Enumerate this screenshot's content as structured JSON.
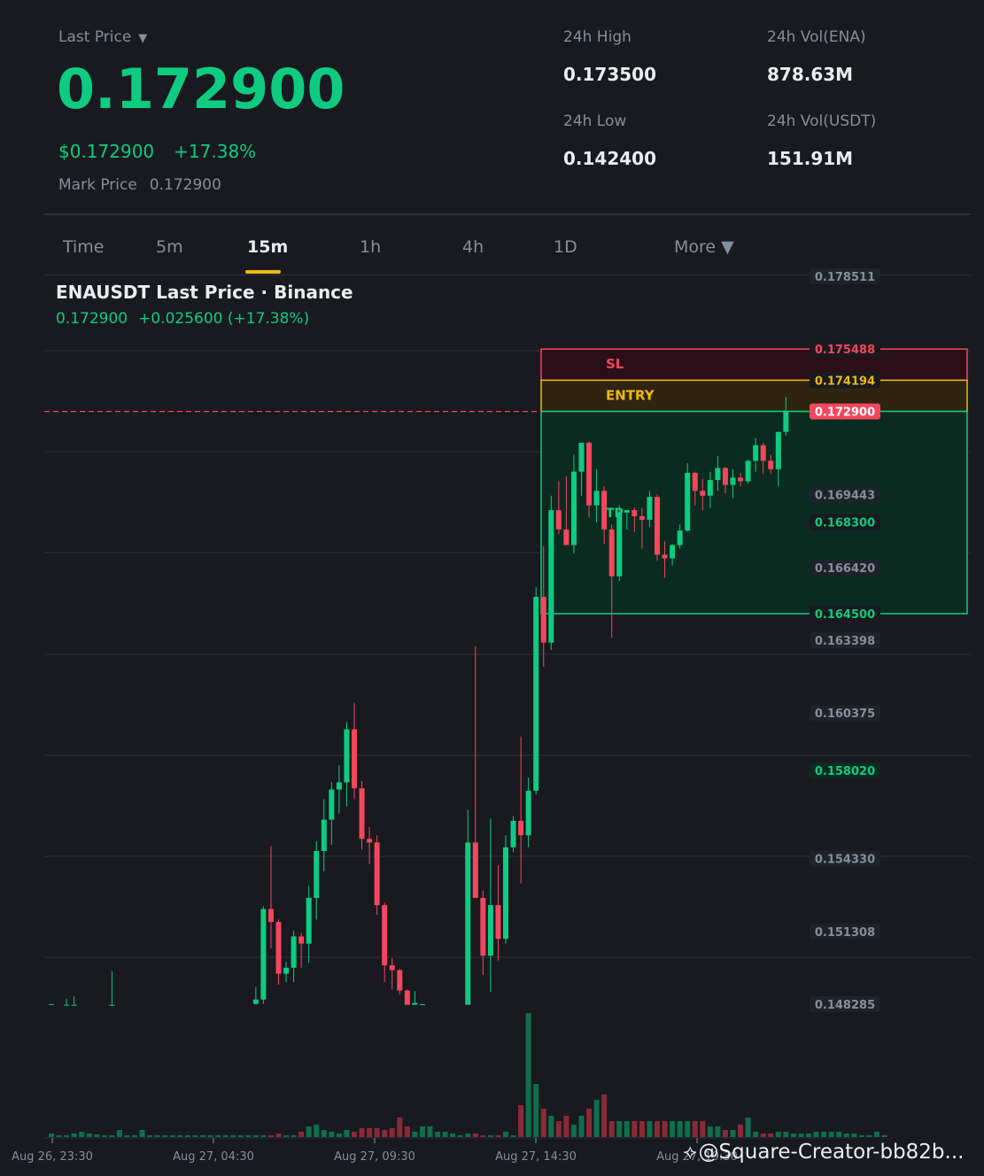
{
  "header": {
    "last_price_label": "Last Price",
    "last_price": "0.172900",
    "usd_price": "$0.172900",
    "change_pct": "+17.38%",
    "mark_price_label": "Mark Price",
    "mark_price": "0.172900",
    "stats": {
      "high_label": "24h High",
      "high": "0.173500",
      "low_label": "24h Low",
      "low": "0.142400",
      "vol_base_label": "24h Vol(ENA)",
      "vol_base": "878.63M",
      "vol_quote_label": "24h Vol(USDT)",
      "vol_quote": "151.91M"
    }
  },
  "tabs": [
    "Time",
    "5m",
    "15m",
    "1h",
    "4h",
    "1D",
    "More ▼"
  ],
  "active_tab": "15m",
  "chart": {
    "title": "ENAUSDT Last Price · Binance",
    "sub_price": "0.172900",
    "sub_change": "+0.025600 (+17.38%)"
  },
  "watermark": "@Square-Creator-bb82b...",
  "colors": {
    "up": "#0ecb81",
    "down": "#f6465d",
    "accent": "#f0b90b",
    "bg": "#181a20"
  },
  "chart_data": {
    "type": "candlestick",
    "symbol": "ENAUSDT",
    "interval": "15m",
    "price_range": [
      0.148285,
      0.178511
    ],
    "y_tick_labels": [
      "0.178511",
      "0.175488",
      "0.174194",
      "0.172900",
      "0.169443",
      "0.168300",
      "0.166420",
      "0.164500",
      "0.163398",
      "0.160375",
      "0.158020",
      "0.154330",
      "0.151308",
      "0.148285"
    ],
    "x_tick_labels": [
      "Aug 26, 23:30",
      "Aug 27, 04:30",
      "Aug 27, 09:30",
      "Aug 27, 14:30",
      "Aug 27, 19:30"
    ],
    "levels": {
      "stop_loss": {
        "label": "SL",
        "price": 0.175488
      },
      "entry": {
        "label": "ENTRY",
        "price": 0.174194
      },
      "last_price": {
        "price": 0.1729
      },
      "take_profit": {
        "label": "TP",
        "price": 0.1645
      }
    },
    "candles": [
      [
        0.14829,
        0.14829,
        0.14826,
        0.14829
      ],
      [
        0.14826,
        0.14826,
        0.14826,
        0.14829
      ],
      [
        0.14826,
        0.14851,
        0.14826,
        0.14826
      ],
      [
        0.14826,
        0.14861,
        0.14826,
        0.14826
      ],
      [
        0.14826,
        0.14826,
        0.14826,
        0.14829
      ],
      [
        0.14826,
        0.14826,
        0.14826,
        0.14826
      ],
      [
        0.14826,
        0.14826,
        0.14826,
        0.14826
      ],
      [
        0.14826,
        0.14826,
        0.14826,
        0.14826
      ],
      [
        0.14826,
        0.14965,
        0.14826,
        0.14826
      ],
      [
        0.14826,
        0.14826,
        0.14826,
        0.14826
      ],
      [
        0.14826,
        0.14826,
        0.14826,
        0.14826
      ],
      [
        0.14826,
        0.14826,
        0.14826,
        0.14826
      ],
      [
        0.14826,
        0.14826,
        0.14826,
        0.14826
      ],
      [
        0.14826,
        0.14826,
        0.14826,
        0.14826
      ],
      [
        0.14826,
        0.14826,
        0.14826,
        0.14826
      ],
      [
        0.14826,
        0.14826,
        0.14826,
        0.14826
      ],
      [
        0.14826,
        0.14826,
        0.14826,
        0.14826
      ],
      [
        0.14826,
        0.14826,
        0.14826,
        0.14826
      ],
      [
        0.14826,
        0.14826,
        0.14826,
        0.14826
      ],
      [
        0.14826,
        0.14826,
        0.14826,
        0.14826
      ],
      [
        0.14826,
        0.14826,
        0.14826,
        0.14826
      ],
      [
        0.14826,
        0.14826,
        0.14826,
        0.14826
      ],
      [
        0.14826,
        0.14826,
        0.14826,
        0.14826
      ],
      [
        0.14826,
        0.14826,
        0.14826,
        0.14826
      ],
      [
        0.14826,
        0.14826,
        0.14826,
        0.14826
      ],
      [
        0.14826,
        0.14826,
        0.14826,
        0.14826
      ],
      [
        0.14826,
        0.14826,
        0.14826,
        0.14826
      ],
      [
        0.1483,
        0.149,
        0.14826,
        0.14848
      ],
      [
        0.14848,
        0.15235,
        0.1483,
        0.15224
      ],
      [
        0.15224,
        0.15485,
        0.1506,
        0.1517
      ],
      [
        0.1517,
        0.1518,
        0.1491,
        0.14955
      ],
      [
        0.14955,
        0.15005,
        0.1492,
        0.1498
      ],
      [
        0.1498,
        0.15135,
        0.1492,
        0.1511
      ],
      [
        0.1511,
        0.15125,
        0.1498,
        0.1508
      ],
      [
        0.1508,
        0.1532,
        0.15,
        0.1527
      ],
      [
        0.1527,
        0.15505,
        0.1518,
        0.15465
      ],
      [
        0.15465,
        0.1568,
        0.1538,
        0.15595
      ],
      [
        0.15595,
        0.1575,
        0.1549,
        0.1572
      ],
      [
        0.1572,
        0.1582,
        0.1562,
        0.1575
      ],
      [
        0.1575,
        0.16,
        0.1565,
        0.1597
      ],
      [
        0.1597,
        0.1608,
        0.1568,
        0.15725
      ],
      [
        0.15725,
        0.15755,
        0.1547,
        0.15515
      ],
      [
        0.15515,
        0.15565,
        0.1541,
        0.155
      ],
      [
        0.155,
        0.1553,
        0.152,
        0.1524
      ],
      [
        0.1524,
        0.1525,
        0.1492,
        0.1499
      ],
      [
        0.1499,
        0.1502,
        0.1489,
        0.1497
      ],
      [
        0.1497,
        0.14975,
        0.1487,
        0.14885
      ],
      [
        0.14885,
        0.1489,
        0.14826,
        0.14826
      ],
      [
        0.14826,
        0.14883,
        0.14826,
        0.14834
      ],
      [
        0.14826,
        0.1483,
        0.14826,
        0.14828
      ],
      [
        0.14826,
        0.14826,
        0.14826,
        0.14826
      ],
      [
        0.14826,
        0.14826,
        0.14826,
        0.14826
      ],
      [
        0.14826,
        0.14826,
        0.14826,
        0.14826
      ],
      [
        0.14826,
        0.14826,
        0.14826,
        0.14826
      ],
      [
        0.14826,
        0.14826,
        0.14826,
        0.14826
      ],
      [
        0.14826,
        0.15635,
        0.14826,
        0.155
      ],
      [
        0.155,
        0.16315,
        0.1533,
        0.1527
      ],
      [
        0.1527,
        0.153,
        0.1495,
        0.1503
      ],
      [
        0.1503,
        0.156,
        0.1488,
        0.1524
      ],
      [
        0.1524,
        0.15405,
        0.1501,
        0.151
      ],
      [
        0.151,
        0.1553,
        0.1508,
        0.1548
      ],
      [
        0.1548,
        0.1561,
        0.1546,
        0.1559
      ],
      [
        0.1559,
        0.1594,
        0.1533,
        0.1553
      ],
      [
        0.1553,
        0.1577,
        0.1548,
        0.15715
      ],
      [
        0.15715,
        0.1656,
        0.157,
        0.1652
      ],
      [
        0.1652,
        0.1673,
        0.1623,
        0.1633
      ],
      [
        0.1633,
        0.1694,
        0.163,
        0.1688
      ],
      [
        0.1688,
        0.17,
        0.1678,
        0.168
      ],
      [
        0.168,
        0.1702,
        0.1676,
        0.16735
      ],
      [
        0.16735,
        0.1711,
        0.167,
        0.1704
      ],
      [
        0.1704,
        0.1712,
        0.1694,
        0.1716
      ],
      [
        0.1716,
        0.17165,
        0.1685,
        0.169
      ],
      [
        0.169,
        0.1705,
        0.1683,
        0.1696
      ],
      [
        0.1696,
        0.1698,
        0.1674,
        0.168
      ],
      [
        0.168,
        0.1682,
        0.1635,
        0.16605
      ],
      [
        0.16605,
        0.169,
        0.16585,
        0.1687
      ],
      [
        0.1687,
        0.1688,
        0.168,
        0.1688
      ],
      [
        0.1688,
        0.1689,
        0.1679,
        0.16855
      ],
      [
        0.16855,
        0.1689,
        0.1672,
        0.1684
      ],
      [
        0.1684,
        0.1696,
        0.1681,
        0.16935
      ],
      [
        0.16935,
        0.16945,
        0.1667,
        0.16695
      ],
      [
        0.16695,
        0.1675,
        0.166,
        0.1668
      ],
      [
        0.1668,
        0.1674,
        0.1665,
        0.16735
      ],
      [
        0.16735,
        0.1682,
        0.1672,
        0.16795
      ],
      [
        0.16795,
        0.17075,
        0.1679,
        0.17035
      ],
      [
        0.17035,
        0.1704,
        0.169,
        0.1696
      ],
      [
        0.1696,
        0.1701,
        0.1688,
        0.1694
      ],
      [
        0.1694,
        0.1704,
        0.1689,
        0.17005
      ],
      [
        0.17005,
        0.17105,
        0.1696,
        0.17055
      ],
      [
        0.17055,
        0.1706,
        0.1695,
        0.16985
      ],
      [
        0.16985,
        0.1705,
        0.1693,
        0.17015
      ],
      [
        0.17015,
        0.17035,
        0.1698,
        0.17
      ],
      [
        0.17,
        0.1709,
        0.1699,
        0.17085
      ],
      [
        0.17085,
        0.1718,
        0.1704,
        0.1715
      ],
      [
        0.1715,
        0.1716,
        0.1703,
        0.17085
      ],
      [
        0.17085,
        0.1711,
        0.1703,
        0.1705
      ],
      [
        0.1705,
        0.172,
        0.1698,
        0.17205
      ],
      [
        0.17205,
        0.1735,
        0.1719,
        0.1729
      ]
    ],
    "volumes": [
      4,
      2,
      2,
      4,
      6,
      4,
      3,
      2,
      2,
      8,
      2,
      2,
      8,
      2,
      2,
      2,
      2,
      2,
      2,
      2,
      2,
      2,
      2,
      2,
      2,
      2,
      2,
      2,
      2,
      2,
      4,
      2,
      2,
      6,
      12,
      14,
      8,
      6,
      4,
      8,
      6,
      10,
      10,
      10,
      8,
      10,
      22,
      12,
      6,
      12,
      12,
      6,
      6,
      4,
      2,
      4,
      4,
      2,
      2,
      2,
      6,
      2,
      36,
      140,
      60,
      32,
      24,
      18,
      24,
      14,
      24,
      32,
      42,
      48,
      18,
      18,
      18,
      18,
      18,
      18,
      18,
      18,
      18,
      18,
      18,
      18,
      18,
      12,
      12,
      8,
      8,
      14,
      22,
      6,
      4,
      4,
      6,
      6,
      4,
      4,
      4,
      6,
      6,
      6,
      6,
      4,
      4,
      2,
      2,
      6,
      2
    ]
  }
}
